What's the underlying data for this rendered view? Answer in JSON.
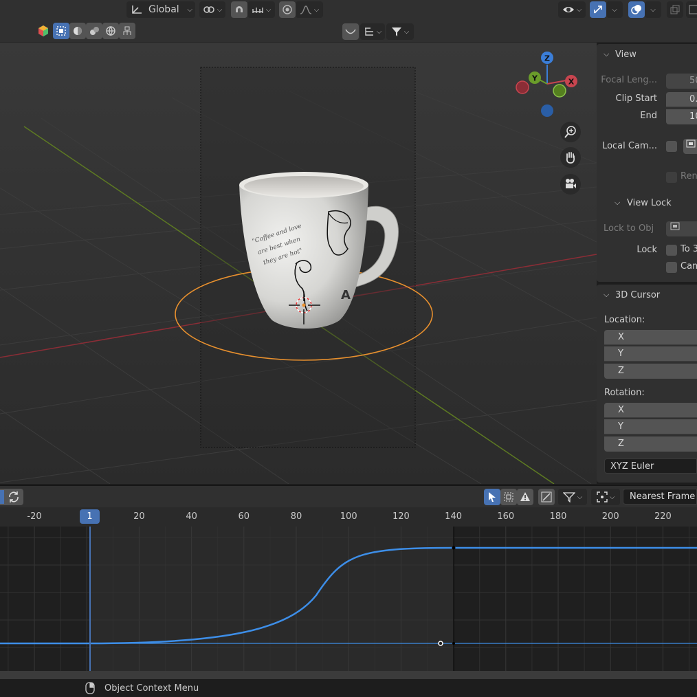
{
  "header": {
    "transform_orientation": "Global",
    "search_placeholder": ""
  },
  "viewport": {
    "overlay_labels": {
      "x": "X",
      "y": "Y",
      "z": "Z"
    },
    "mug_text": "\"Coffee and love are best when they are hot\""
  },
  "npanel": {
    "view": {
      "title": "View",
      "focal_length_label": "Focal Leng...",
      "focal_length_value": "50",
      "clip_start_label": "Clip Start",
      "clip_start_value": "0.",
      "end_label": "End",
      "end_value": "10",
      "local_camera_label": "Local Cam...",
      "render_region_label": "Ren",
      "view_lock_title": "View Lock",
      "lock_to_obj_label": "Lock to Obj",
      "lock_label": "Lock",
      "lock_to_3d_label": "To 3",
      "lock_camera_label": "Cam"
    },
    "cursor": {
      "title": "3D Cursor",
      "location_label": "Location:",
      "location_axes": [
        "X",
        "Y",
        "Z"
      ],
      "rotation_label": "Rotation:",
      "rotation_axes": [
        "X",
        "Y",
        "Z"
      ],
      "rotation_mode": "XYZ Euler"
    }
  },
  "graph_editor": {
    "snap_mode": "Nearest Frame",
    "current_frame": "1",
    "ruler_ticks": [
      "-20",
      "20",
      "40",
      "60",
      "80",
      "100",
      "120",
      "140",
      "160",
      "180",
      "200",
      "220"
    ]
  },
  "status_bar": {
    "hint": "Object Context Menu"
  },
  "colors": {
    "accent": "#4772b3",
    "selection_outline": "#e8902e",
    "axis_x": "#c8454f",
    "axis_y": "#6a9c2a",
    "axis_z": "#3b7ed8",
    "curve": "#3d8ee8"
  }
}
